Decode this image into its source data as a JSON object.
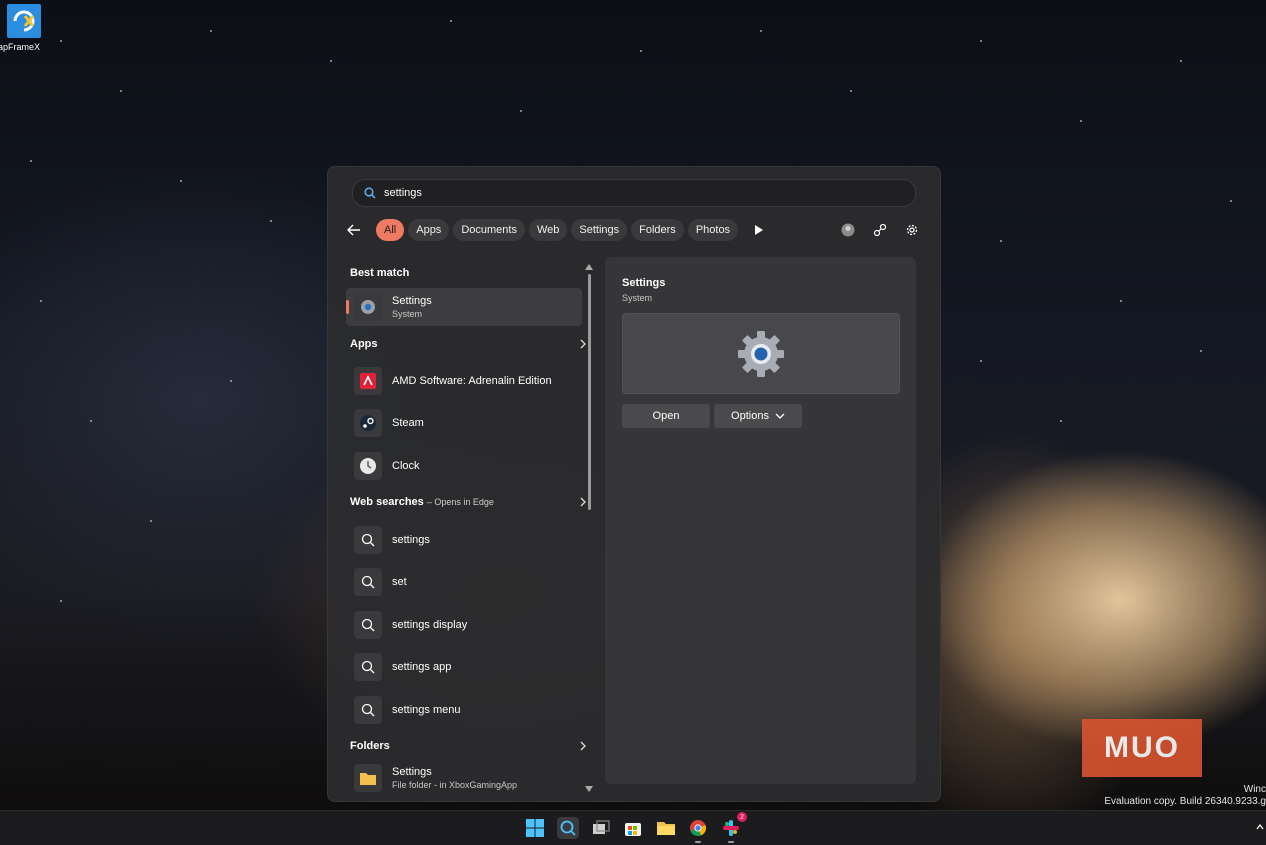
{
  "desktop": {
    "icon_label": "apFrameX",
    "watermark_line1": "Winc",
    "watermark_line2": "Evaluation copy. Build 26340.9233.g",
    "logo_text": "MUO"
  },
  "search": {
    "query": "settings"
  },
  "filters": [
    "All",
    "Apps",
    "Documents",
    "Web",
    "Settings",
    "Folders",
    "Photos"
  ],
  "results": {
    "best_match_title": "Best match",
    "best_match": {
      "name": "Settings",
      "sub": "System"
    },
    "apps_title": "Apps",
    "apps": [
      {
        "name": "AMD Software: Adrenalin Edition",
        "icon": "amd-icon"
      },
      {
        "name": "Steam",
        "icon": "steam-icon"
      },
      {
        "name": "Clock",
        "icon": "clock-icon"
      }
    ],
    "web_title": "Web searches",
    "web_sub": "– Opens in Edge",
    "web": [
      "settings",
      "set",
      "settings display",
      "settings app",
      "settings menu"
    ],
    "folders_title": "Folders",
    "folder": {
      "name": "Settings",
      "sub": "File folder - in XboxGamingApp"
    }
  },
  "preview": {
    "title": "Settings",
    "subtitle": "System",
    "open_label": "Open",
    "options_label": "Options"
  },
  "taskbar": {
    "icons": [
      "windows-start-icon",
      "search-icon",
      "task-view-icon",
      "store-icon",
      "file-explorer-icon",
      "chrome-icon",
      "slack-icon"
    ],
    "slack_badge": "2"
  },
  "colors": {
    "accent": "#ef7a62",
    "panel": "#2c2c2e"
  }
}
